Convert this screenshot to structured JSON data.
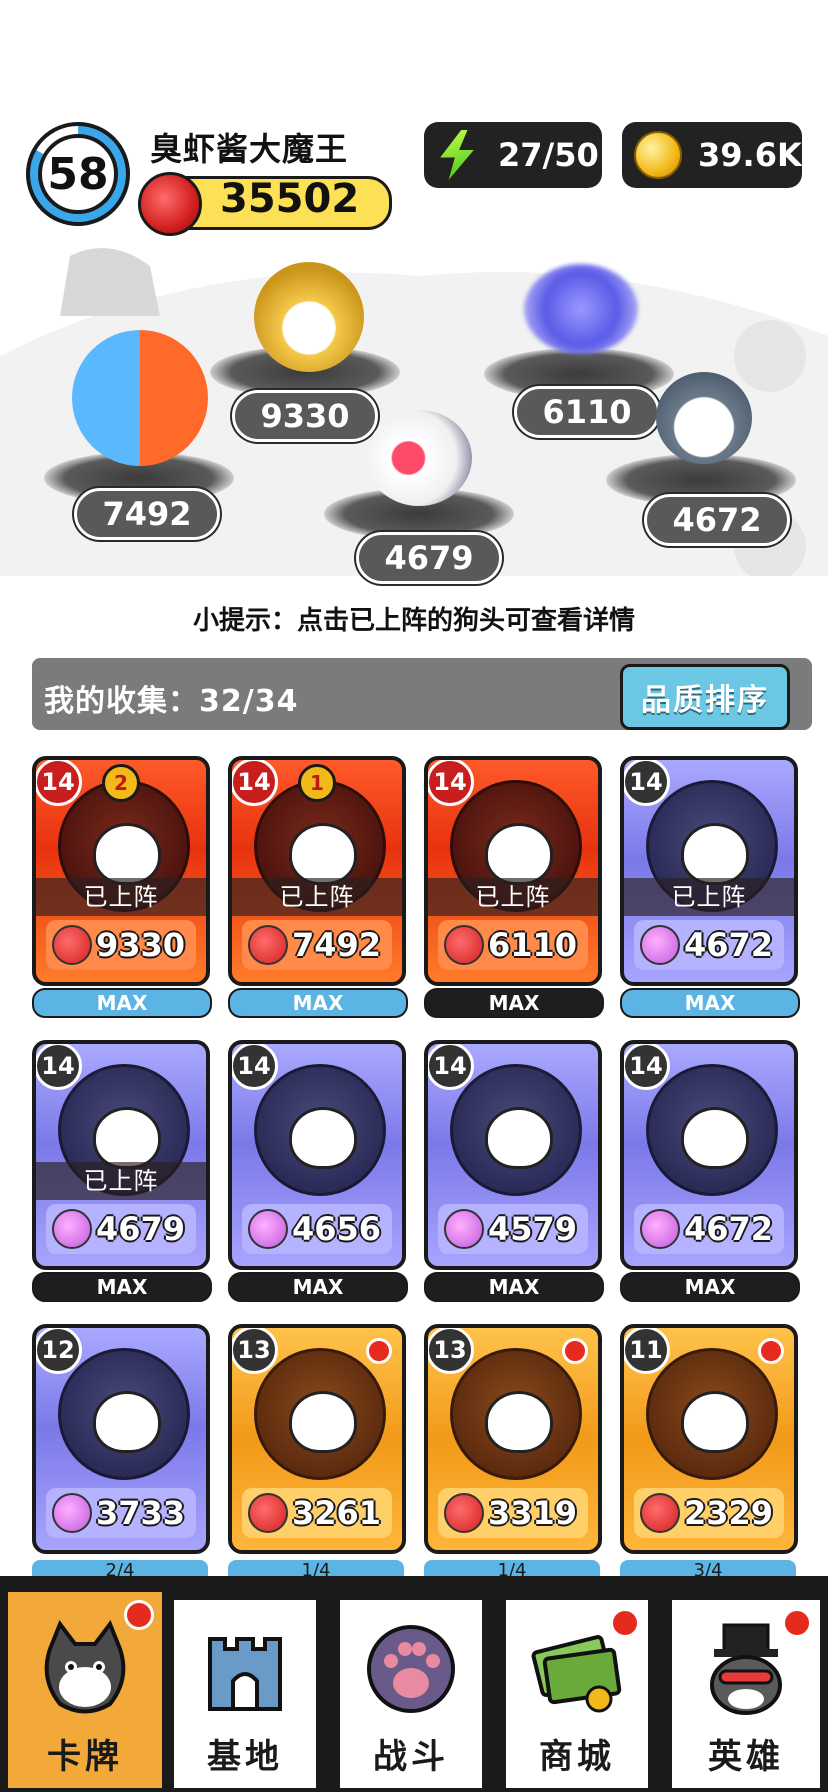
{
  "header": {
    "level": "58",
    "level_progress": 0.83,
    "player_name": "臭虾酱大魔王",
    "power": "35502",
    "energy": "27/50",
    "coins": "39.6K"
  },
  "arena": {
    "deployed_powers": [
      "9330",
      "7492",
      "6110",
      "4679",
      "4672"
    ]
  },
  "hint": "小提示：点击已上阵的狗头可查看详情",
  "collection": {
    "label": "我的收集：32/34",
    "sort_button": "品质排序"
  },
  "cards": [
    {
      "level": "14",
      "rank": "2",
      "deployed": "已上阵",
      "power": "9330",
      "bar": "MAX",
      "tier": "red"
    },
    {
      "level": "14",
      "rank": "1",
      "deployed": "已上阵",
      "power": "7492",
      "bar": "MAX",
      "tier": "red"
    },
    {
      "level": "14",
      "rank": "",
      "deployed": "已上阵",
      "power": "6110",
      "bar": "MAX",
      "tier": "red"
    },
    {
      "level": "14",
      "rank": "",
      "deployed": "已上阵",
      "power": "4672",
      "bar": "MAX",
      "tier": "purple"
    },
    {
      "level": "14",
      "rank": "",
      "deployed": "已上阵",
      "power": "4679",
      "bar": "MAX",
      "tier": "purple"
    },
    {
      "level": "14",
      "rank": "",
      "deployed": "",
      "power": "4656",
      "bar": "MAX",
      "tier": "purple"
    },
    {
      "level": "14",
      "rank": "",
      "deployed": "",
      "power": "4579",
      "bar": "MAX",
      "tier": "purple"
    },
    {
      "level": "14",
      "rank": "",
      "deployed": "",
      "power": "4672",
      "bar": "MAX",
      "tier": "purple"
    },
    {
      "level": "12",
      "rank": "",
      "deployed": "",
      "power": "3733",
      "bar": "2/4",
      "tier": "purple"
    },
    {
      "level": "13",
      "rank": "",
      "deployed": "",
      "power": "3261",
      "bar": "1/4",
      "tier": "gold"
    },
    {
      "level": "13",
      "rank": "",
      "deployed": "",
      "power": "3319",
      "bar": "1/4",
      "tier": "gold"
    },
    {
      "level": "11",
      "rank": "",
      "deployed": "",
      "power": "2329",
      "bar": "3/4",
      "tier": "gold"
    }
  ],
  "nav": {
    "cards": "卡牌",
    "base": "基地",
    "battle": "战斗",
    "shop": "商城",
    "heroes": "英雄"
  },
  "colors": {
    "accent_yellow": "#fce055",
    "sort_button": "#6cc7e4",
    "nav_active": "#f2a93a",
    "notify_red": "#e52a1e"
  }
}
